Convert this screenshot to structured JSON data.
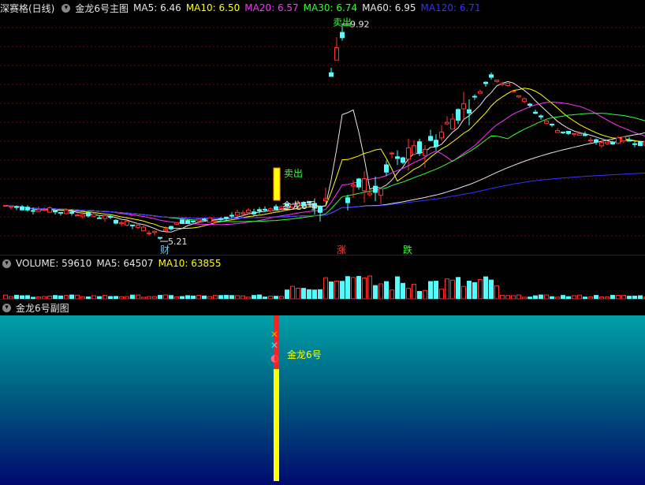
{
  "header": {
    "stock_name": "深赛格(日线)",
    "main_indicator": "金龙6号主图",
    "ma": [
      {
        "label": "MA5:",
        "value": "6.46",
        "color": "#e6e6e6"
      },
      {
        "label": "MA10:",
        "value": "6.50",
        "color": "#ffff00"
      },
      {
        "label": "MA20:",
        "value": "6.57",
        "color": "#ff33ff"
      },
      {
        "label": "MA30:",
        "value": "6.74",
        "color": "#33ff33"
      },
      {
        "label": "MA60:",
        "value": "6.95",
        "color": "#e6e6e6"
      },
      {
        "label": "MA120:",
        "value": "6.71",
        "color": "#3333ff"
      }
    ]
  },
  "volume_header": {
    "label": "VOLUME:",
    "value": "59610",
    "ma5_label": "MA5:",
    "ma5_value": "64507",
    "ma10_label": "MA10:",
    "ma10_value": "63855"
  },
  "sub_header": {
    "title": "金龙6号副图"
  },
  "chart_data": {
    "type": "candlestick",
    "price_range": [
      4.9,
      10.1
    ],
    "annotations": {
      "high_label": "9.92",
      "low_label": "5.21",
      "sell_label_top": "卖出",
      "sell_label_mid": "卖出",
      "signal_label_main": "金龙6号",
      "signal_label_sub": "金龙6号"
    },
    "markers": [
      {
        "text": "财",
        "color": "#66ccff"
      },
      {
        "text": "涨",
        "color": "#ff4444"
      },
      {
        "text": "跌",
        "color": "#33ff33"
      }
    ],
    "colors": {
      "up": "#ff3232",
      "down": "#54fcfc",
      "ma5": "#e6e6e6",
      "ma10": "#ffff00",
      "ma20": "#ff33ff",
      "ma30": "#33ff33",
      "ma60": "#e6e6e6",
      "ma120": "#3333ff",
      "grid": "#800000",
      "signal_bar": "#ffff00",
      "signal_bar_top": "#ff2020"
    }
  }
}
